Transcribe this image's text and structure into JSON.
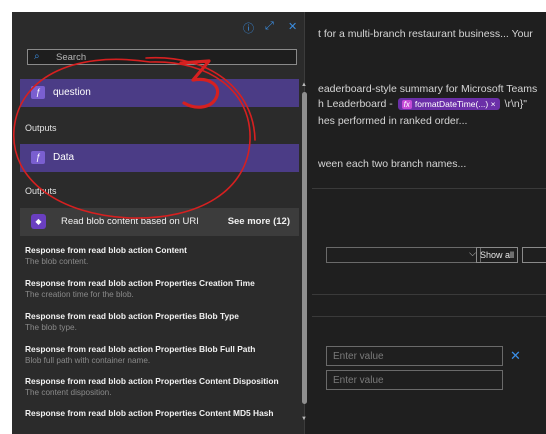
{
  "background": {
    "line1": "t for a multi-branch restaurant business... Your",
    "line2": "eaderboard-style summary for Microsoft Teams",
    "line3_prefix": "h Leaderboard -",
    "chip_fx": "fx",
    "chip_label": "formatDateTime(...)",
    "chip_close": "×",
    "line3_suffix": "\\r\\n}\"",
    "line4": "hes performed in ranked order...",
    "line5": "ween each two branch names...",
    "show_all": "Show all",
    "enter_value_1": "Enter value",
    "enter_value_2": "Enter value",
    "close_glyph": "✕"
  },
  "flyout": {
    "top_icons": {
      "info": "ⓘ",
      "expand": "⤢",
      "close": "✕"
    },
    "search_placeholder": "Search",
    "question_label": "question",
    "outputs_label_1": "Outputs",
    "data_label": "Data",
    "outputs_label_2": "Outputs",
    "blob_section_label": "Read blob content based on URI",
    "see_more": "See more (12)",
    "items": [
      {
        "title": "Response from read blob action Content",
        "desc": "The blob content."
      },
      {
        "title": "Response from read blob action Properties Creation Time",
        "desc": "The creation time for the blob."
      },
      {
        "title": "Response from read blob action Properties Blob Type",
        "desc": "The blob type."
      },
      {
        "title": "Response from read blob action Properties Blob Full Path",
        "desc": "Blob full path with container name."
      },
      {
        "title": "Response from read blob action Properties Content Disposition",
        "desc": "The content disposition."
      },
      {
        "title": "Response from read blob action Properties Content MD5 Hash",
        "desc": ""
      }
    ]
  },
  "annotation": {
    "number": "3",
    "color": "#d62020"
  }
}
